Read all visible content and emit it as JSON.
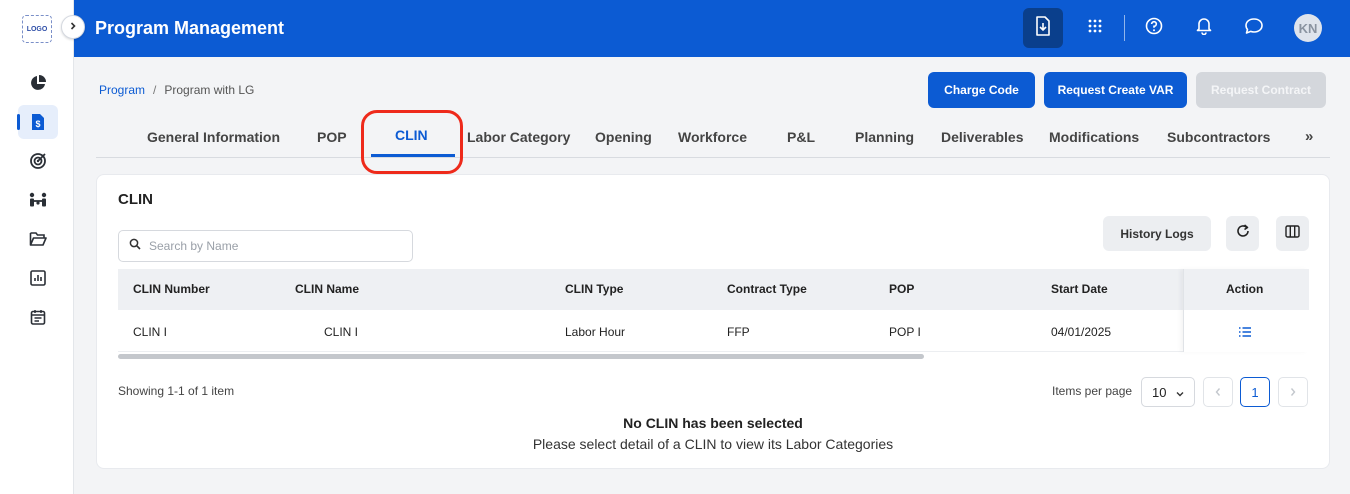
{
  "sidebar": {
    "logo_text": "LOGO",
    "items": [
      {
        "icon": "pie-chart-icon"
      },
      {
        "icon": "dollar-document-icon",
        "active": true
      },
      {
        "icon": "target-icon"
      },
      {
        "icon": "team-icon"
      },
      {
        "icon": "folder-open-icon"
      },
      {
        "icon": "bar-chart-icon"
      },
      {
        "icon": "calendar-icon"
      }
    ]
  },
  "header": {
    "title": "Program Management",
    "avatar_initials": "KN",
    "icons": [
      "download-icon",
      "apps-grid-icon",
      "help-icon",
      "bell-icon",
      "chat-icon"
    ]
  },
  "breadcrumb": {
    "root": "Program",
    "separator": "/",
    "current": "Program with LG"
  },
  "actions": {
    "charge_code": "Charge Code",
    "request_create_var": "Request Create VAR",
    "request_contract": "Request Contract"
  },
  "tabs": [
    {
      "label": "General Information"
    },
    {
      "label": "POP"
    },
    {
      "label": "CLIN",
      "active": true
    },
    {
      "label": "Labor Category"
    },
    {
      "label": "Opening"
    },
    {
      "label": "Workforce"
    },
    {
      "label": "P&L"
    },
    {
      "label": "Planning"
    },
    {
      "label": "Deliverables"
    },
    {
      "label": "Modifications"
    },
    {
      "label": "Subcontractors"
    }
  ],
  "tabs_more": "»",
  "clin": {
    "title": "CLIN",
    "search_placeholder": "Search by Name",
    "search_value": "",
    "history_logs": "History Logs",
    "columns": [
      "CLIN Number",
      "CLIN Name",
      "CLIN Type",
      "Contract Type",
      "POP",
      "Start Date",
      "Action"
    ],
    "rows": [
      {
        "clin_number": "CLIN I",
        "clin_name": "CLIN I",
        "clin_type": "Labor Hour",
        "contract_type": "FFP",
        "pop": "POP I",
        "start_date": "04/01/2025"
      }
    ],
    "showing": "Showing 1-1 of 1 item",
    "items_per_page_label": "Items per page",
    "items_per_page": "10",
    "current_page": "1",
    "empty_title": "No CLIN has been selected",
    "empty_desc": "Please select detail of a CLIN to view its Labor Categories"
  },
  "colors": {
    "primary": "#0c5bd3",
    "highlight": "#ee2a1b"
  }
}
